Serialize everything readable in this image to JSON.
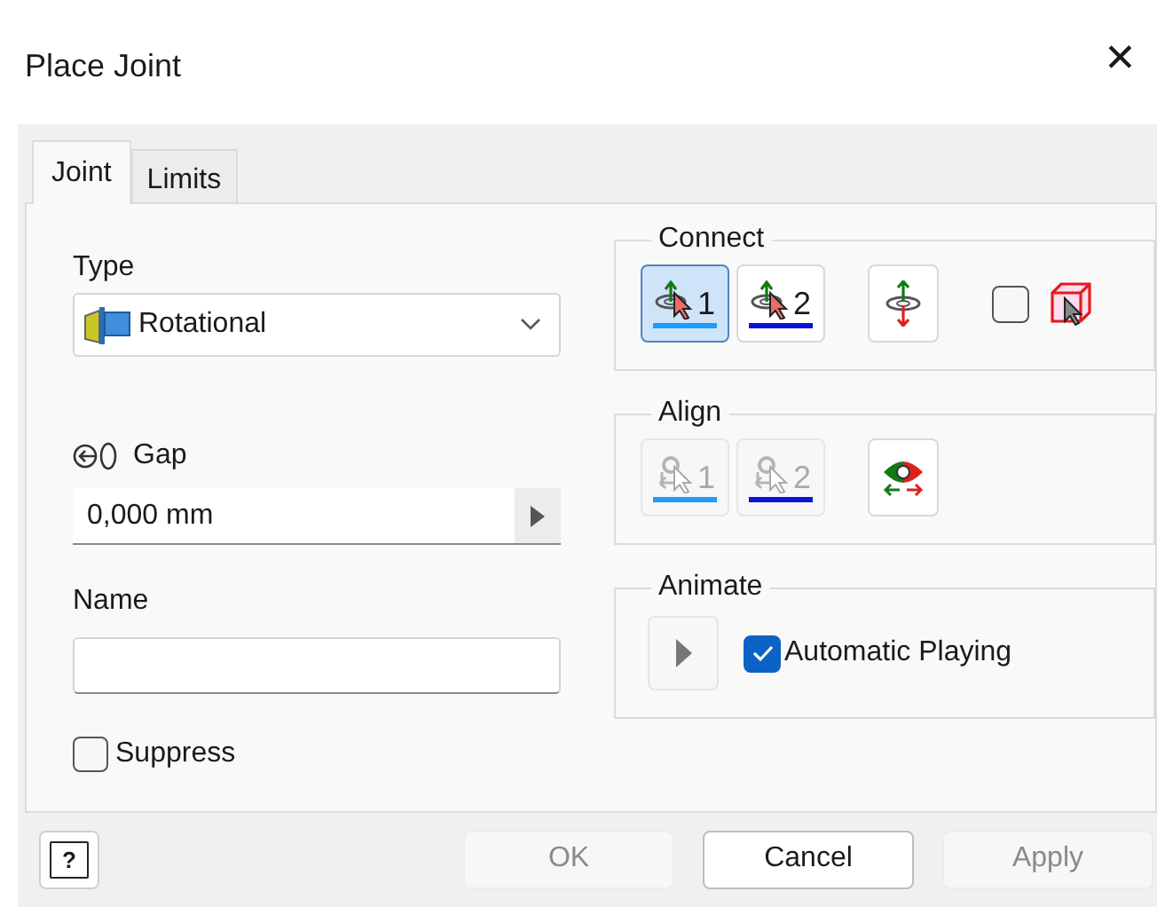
{
  "window": {
    "title": "Place Joint",
    "close": "✕"
  },
  "tabs": [
    {
      "label": "Joint",
      "selected": true
    },
    {
      "label": "Limits",
      "selected": false
    }
  ],
  "type": {
    "label": "Type",
    "value": "Rotational"
  },
  "gap": {
    "label": "Gap",
    "value": "0,000 mm"
  },
  "name": {
    "label": "Name"
  },
  "suppress": {
    "label": "Suppress",
    "checked": false
  },
  "connect": {
    "legend": "Connect",
    "picks": [
      {
        "label": "1",
        "selected": true,
        "color": "#1e9bff"
      },
      {
        "label": "2",
        "selected": false,
        "color": "#0a14d8"
      }
    ],
    "checkbox_checked": false
  },
  "align": {
    "legend": "Align",
    "picks": [
      {
        "label": "1",
        "disabled": true,
        "color": "#1e9bff"
      },
      {
        "label": "2",
        "disabled": true,
        "color": "#0a14d8"
      }
    ]
  },
  "animate": {
    "legend": "Animate",
    "automatic": {
      "label": "Automatic Playing",
      "checked": true
    }
  },
  "footer": {
    "help": "?",
    "buttons": [
      {
        "label": "OK",
        "disabled": true
      },
      {
        "label": "Cancel",
        "disabled": false
      },
      {
        "label": "Apply",
        "disabled": true
      }
    ]
  }
}
